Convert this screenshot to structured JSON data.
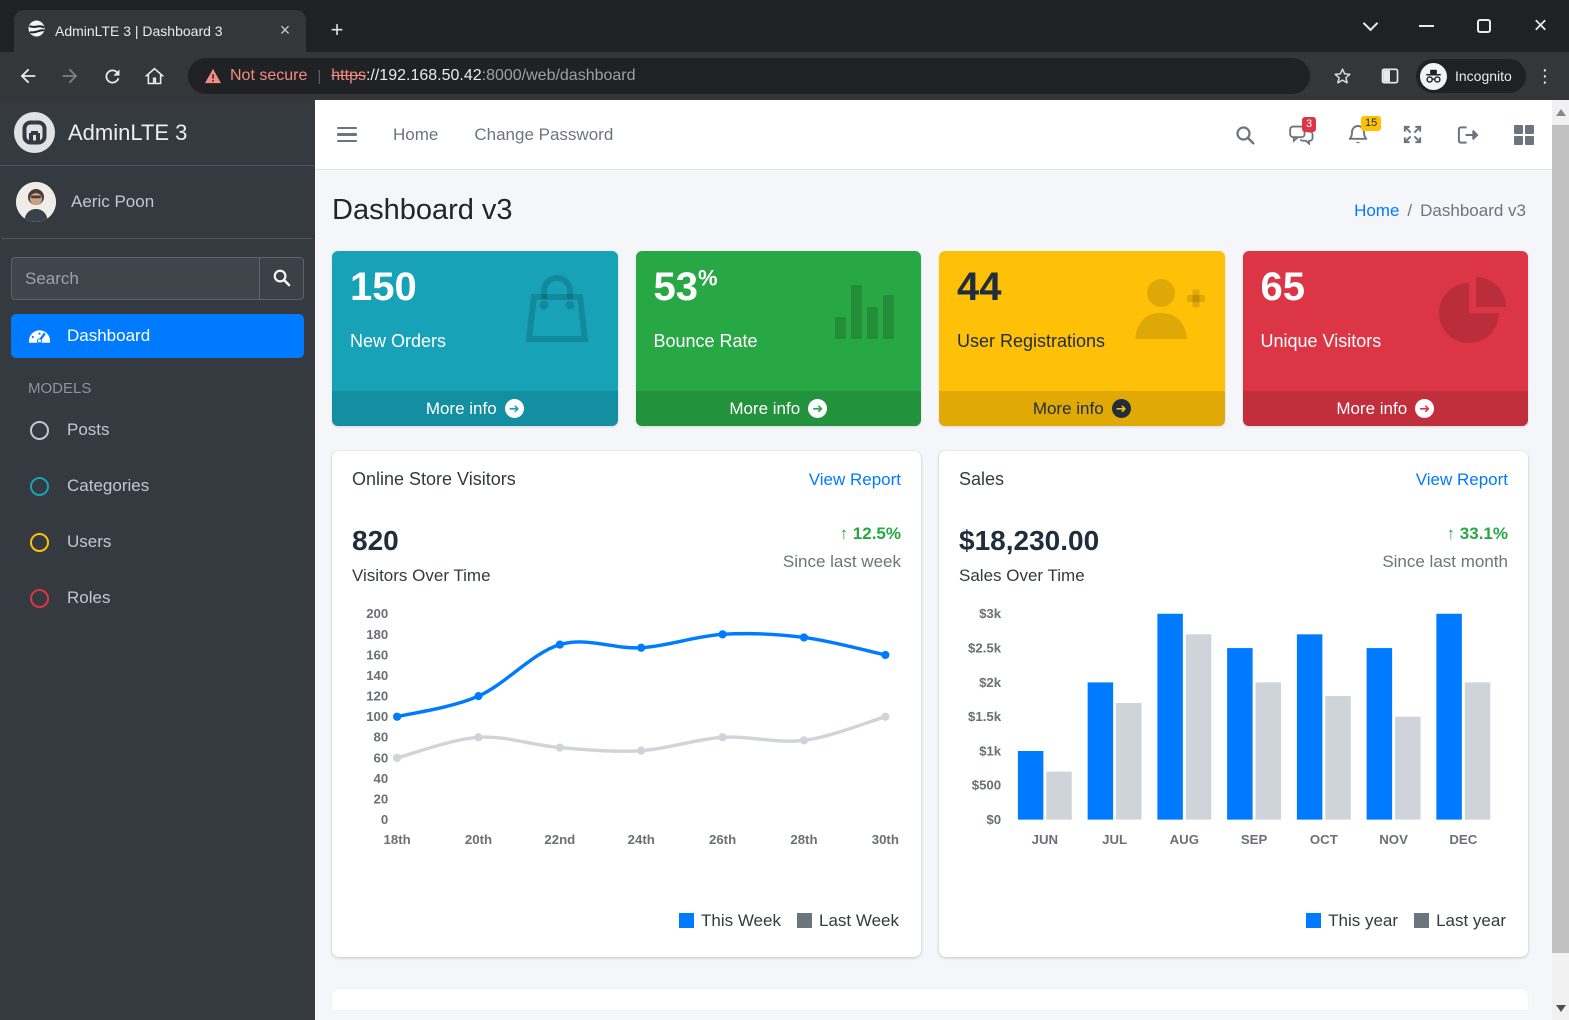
{
  "browser": {
    "tab_title": "AdminLTE 3 | Dashboard 3",
    "close_tab_glyph": "×",
    "new_tab_glyph": "+",
    "menu_glyph": "⋮",
    "incognito_label": "Incognito",
    "url": {
      "warning": "Not secure",
      "divider": "|",
      "scheme": "https",
      "host": "://192.168.50.42",
      "path": ":8000/web/dashboard"
    }
  },
  "sidebar": {
    "brand": "AdminLTE 3",
    "brand_glyph": "A",
    "user_name": "Aeric Poon",
    "search_placeholder": "Search",
    "dashboard_label": "Dashboard",
    "section_header": "MODELS",
    "models": [
      {
        "label": "Posts",
        "color": "#c2c7d0"
      },
      {
        "label": "Categories",
        "color": "#17a2b8"
      },
      {
        "label": "Users",
        "color": "#ffc107"
      },
      {
        "label": "Roles",
        "color": "#dc3545"
      }
    ]
  },
  "navbar": {
    "links": [
      {
        "label": "Home"
      },
      {
        "label": "Change Password"
      }
    ],
    "messages_badge": "3",
    "notifications_badge": "15"
  },
  "page": {
    "title": "Dashboard v3",
    "breadcrumb_home": "Home",
    "breadcrumb_sep": "/",
    "breadcrumb_current": "Dashboard v3"
  },
  "info_boxes": [
    {
      "value": "150",
      "suffix": "",
      "label": "New Orders",
      "more_label": "More info",
      "arrow_glyph": "➜",
      "color": "#17a2b8"
    },
    {
      "value": "53",
      "suffix": "%",
      "label": "Bounce Rate",
      "more_label": "More info",
      "arrow_glyph": "➜",
      "color": "#28a745"
    },
    {
      "value": "44",
      "suffix": "",
      "label": "User Registrations",
      "more_label": "More info",
      "arrow_glyph": "➜",
      "color": "#ffc107"
    },
    {
      "value": "65",
      "suffix": "",
      "label": "Unique Visitors",
      "more_label": "More info",
      "arrow_glyph": "➜",
      "color": "#dc3545"
    }
  ],
  "chart_data": [
    {
      "type": "line",
      "title": "Online Store Visitors",
      "link": "View Report",
      "stat_value": "820",
      "stat_label": "Visitors Over Time",
      "delta_arrow": "↑",
      "delta": "12.5%",
      "delta_note": "Since last week",
      "x": [
        "18th",
        "20th",
        "22nd",
        "24th",
        "26th",
        "28th",
        "30th"
      ],
      "series": [
        {
          "name": "This Week",
          "color": "#007bff",
          "legend_color": "#007bff",
          "values": [
            100,
            120,
            170,
            167,
            180,
            177,
            160
          ]
        },
        {
          "name": "Last Week",
          "color": "#ced4da",
          "legend_color": "#6c757d",
          "values": [
            60,
            80,
            70,
            67,
            80,
            77,
            100
          ]
        }
      ],
      "ylim": [
        0,
        200
      ],
      "yticks": [
        0,
        20,
        40,
        60,
        80,
        100,
        120,
        140,
        160,
        180,
        200
      ],
      "grid": false,
      "legend_position": "bottom-right"
    },
    {
      "type": "bar",
      "title": "Sales",
      "link": "View Report",
      "stat_value": "$18,230.00",
      "stat_label": "Sales Over Time",
      "delta_arrow": "↑",
      "delta": "33.1%",
      "delta_note": "Since last month",
      "x": [
        "JUN",
        "JUL",
        "AUG",
        "SEP",
        "OCT",
        "NOV",
        "DEC"
      ],
      "series": [
        {
          "name": "This year",
          "color": "#007bff",
          "legend_color": "#007bff",
          "values": [
            1000,
            2000,
            3000,
            2500,
            2700,
            2500,
            3000
          ]
        },
        {
          "name": "Last year",
          "color": "#ced4da",
          "legend_color": "#6c757d",
          "values": [
            700,
            1700,
            2700,
            2000,
            1800,
            1500,
            2000
          ]
        }
      ],
      "ylim": [
        0,
        3000
      ],
      "yticks": [
        0,
        500,
        1000,
        1500,
        2000,
        2500,
        3000
      ],
      "ytick_labels": [
        "$0",
        "$500",
        "$1k",
        "$1.5k",
        "$2k",
        "$2.5k",
        "$3k"
      ],
      "grid": false,
      "legend_position": "bottom-right"
    }
  ],
  "colors": {
    "accent": "#007bff",
    "success": "#28a745",
    "warning": "#ffc107",
    "danger": "#dc3545",
    "info": "#17a2b8"
  }
}
